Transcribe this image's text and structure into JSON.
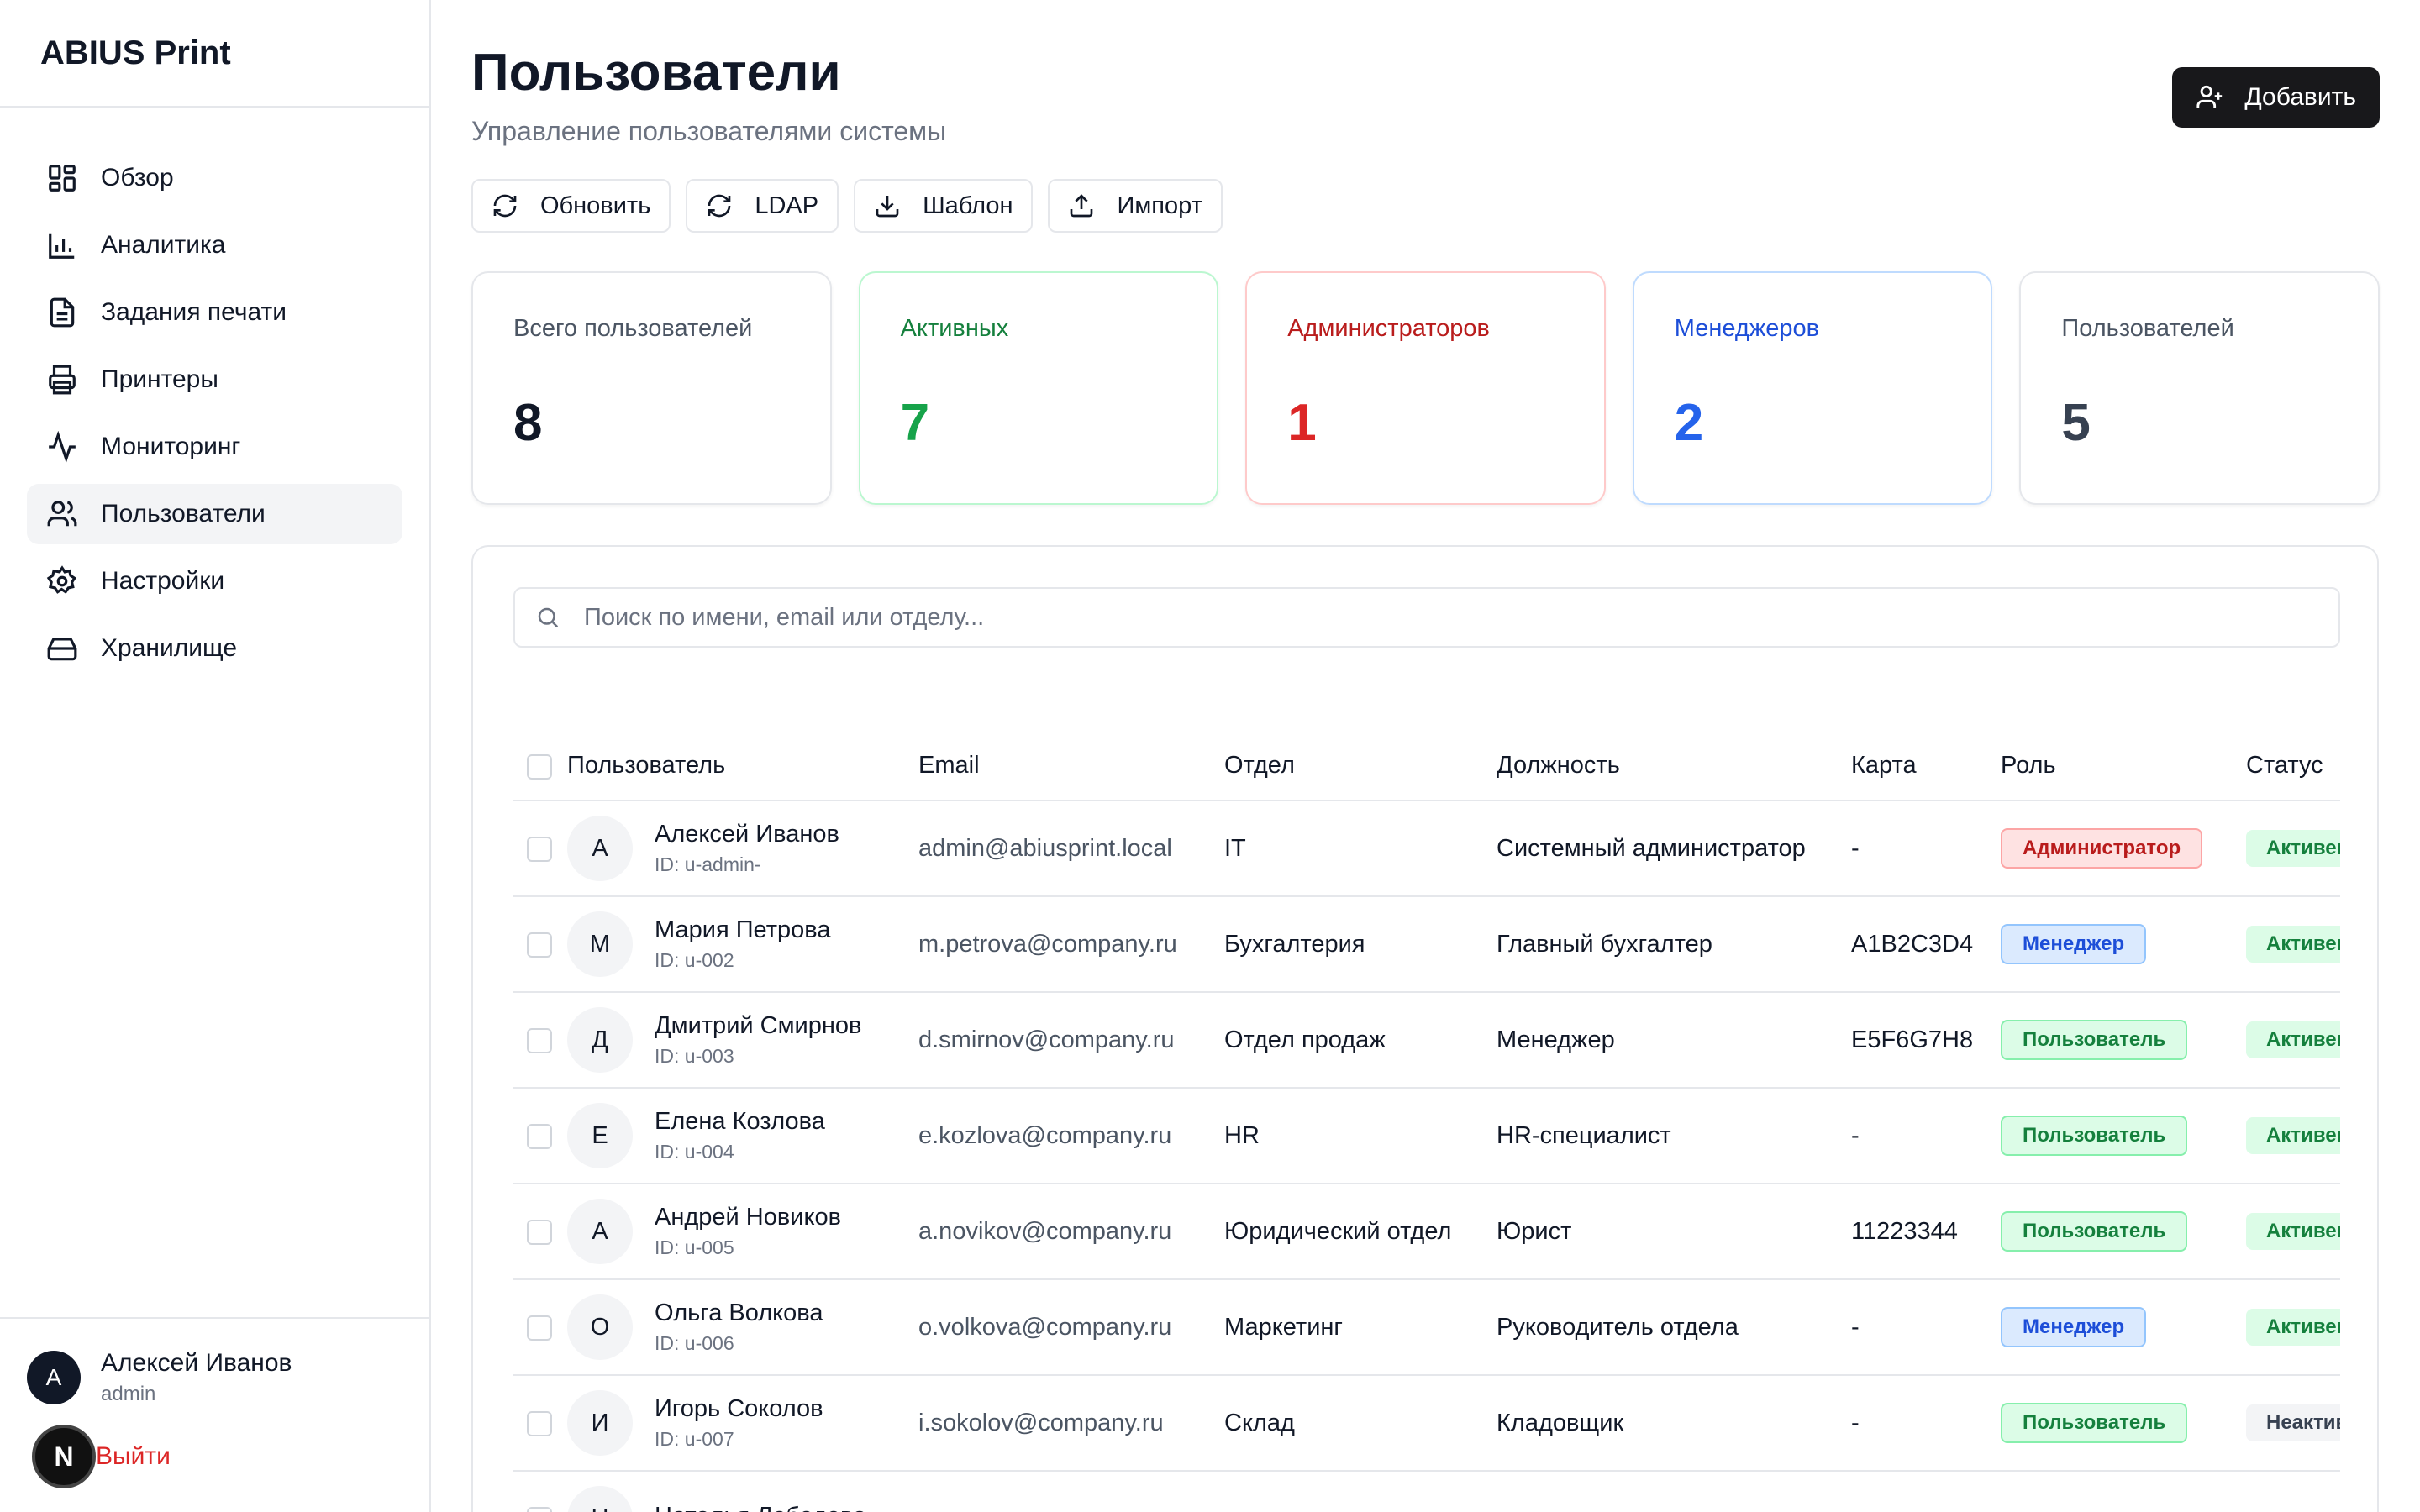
{
  "brand": "ABIUS Print",
  "nav": [
    {
      "label": "Обзор",
      "icon": "dashboard-icon"
    },
    {
      "label": "Аналитика",
      "icon": "bar-chart-icon"
    },
    {
      "label": "Задания печати",
      "icon": "file-text-icon"
    },
    {
      "label": "Принтеры",
      "icon": "printer-icon"
    },
    {
      "label": "Мониторинг",
      "icon": "activity-icon"
    },
    {
      "label": "Пользователи",
      "icon": "users-icon",
      "active": true
    },
    {
      "label": "Настройки",
      "icon": "gear-icon"
    },
    {
      "label": "Хранилище",
      "icon": "hard-drive-icon"
    }
  ],
  "current_user": {
    "avatar": "A",
    "name": "Алексей Иванов",
    "login": "admin"
  },
  "logout_label": "Выйти",
  "dev_badge": "N",
  "page": {
    "title": "Пользователи",
    "subtitle": "Управление пользователями системы",
    "add_label": "Добавить"
  },
  "toolbar": {
    "refresh": "Обновить",
    "ldap": "LDAP",
    "template": "Шаблон",
    "import": "Импорт"
  },
  "stats": {
    "total": {
      "label": "Всего пользователей",
      "value": "8"
    },
    "active": {
      "label": "Активных",
      "value": "7"
    },
    "admins": {
      "label": "Администраторов",
      "value": "1"
    },
    "managers": {
      "label": "Менеджеров",
      "value": "2"
    },
    "users": {
      "label": "Пользователей",
      "value": "5"
    }
  },
  "search": {
    "placeholder": "Поиск по имени, email или отделу..."
  },
  "table": {
    "headers": [
      "Пользователь",
      "Email",
      "Отдел",
      "Должность",
      "Карта",
      "Роль",
      "Статус"
    ],
    "rows": [
      {
        "avatar": "А",
        "name": "Алексей Иванов",
        "id": "ID: u-admin-",
        "email": "admin@abiusprint.local",
        "dept": "IT",
        "position": "Системный администратор",
        "card": "-",
        "role": "Администратор",
        "role_type": "admin",
        "status": "Активен",
        "status_type": "on"
      },
      {
        "avatar": "М",
        "name": "Мария Петрова",
        "id": "ID: u-002",
        "email": "m.petrova@company.ru",
        "dept": "Бухгалтерия",
        "position": "Главный бухгалтер",
        "card": "A1B2C3D4",
        "role": "Менеджер",
        "role_type": "manager",
        "status": "Активен",
        "status_type": "on"
      },
      {
        "avatar": "Д",
        "name": "Дмитрий Смирнов",
        "id": "ID: u-003",
        "email": "d.smirnov@company.ru",
        "dept": "Отдел продаж",
        "position": "Менеджер",
        "card": "E5F6G7H8",
        "role": "Пользователь",
        "role_type": "user",
        "status": "Активен",
        "status_type": "on"
      },
      {
        "avatar": "Е",
        "name": "Елена Козлова",
        "id": "ID: u-004",
        "email": "e.kozlova@company.ru",
        "dept": "HR",
        "position": "HR-специалист",
        "card": "-",
        "role": "Пользователь",
        "role_type": "user",
        "status": "Активен",
        "status_type": "on"
      },
      {
        "avatar": "А",
        "name": "Андрей Новиков",
        "id": "ID: u-005",
        "email": "a.novikov@company.ru",
        "dept": "Юридический отдел",
        "position": "Юрист",
        "card": "11223344",
        "role": "Пользователь",
        "role_type": "user",
        "status": "Активен",
        "status_type": "on"
      },
      {
        "avatar": "О",
        "name": "Ольга Волкова",
        "id": "ID: u-006",
        "email": "o.volkova@company.ru",
        "dept": "Маркетинг",
        "position": "Руководитель отдела",
        "card": "-",
        "role": "Менеджер",
        "role_type": "manager",
        "status": "Активен",
        "status_type": "on"
      },
      {
        "avatar": "И",
        "name": "Игорь Соколов",
        "id": "ID: u-007",
        "email": "i.sokolov@company.ru",
        "dept": "Склад",
        "position": "Кладовщик",
        "card": "-",
        "role": "Пользователь",
        "role_type": "user",
        "status": "Неактивен",
        "status_type": "off"
      },
      {
        "avatar": "Н",
        "name": "Наталья Лебедева",
        "id": "",
        "email": "",
        "dept": "",
        "position": "",
        "card": "",
        "role": "",
        "role_type": "user",
        "status": "",
        "status_type": "on"
      }
    ]
  }
}
